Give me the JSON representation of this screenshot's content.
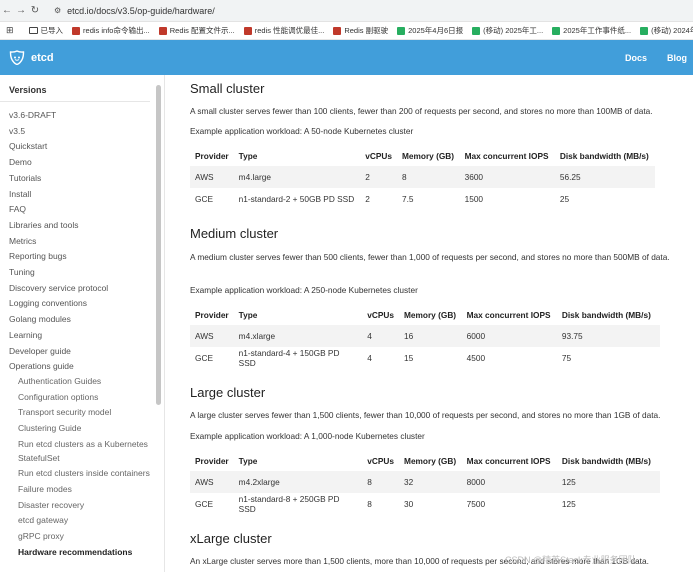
{
  "browser": {
    "url": "etcd.io/docs/v3.5/op-guide/hardware/",
    "bookmarks": [
      {
        "label": "已导入",
        "color": "#555"
      },
      {
        "label": "redis info命令输出...",
        "color": "#c0392b"
      },
      {
        "label": "Redis 配置文件示...",
        "color": "#c0392b"
      },
      {
        "label": "redis 性能调优最佳...",
        "color": "#c0392b"
      },
      {
        "label": "Redis 副驱驶",
        "color": "#c0392b"
      },
      {
        "label": "2025年4月6日报",
        "color": "#27ae60"
      },
      {
        "label": "(移动) 2025年工...",
        "color": "#27ae60"
      },
      {
        "label": "2025年工作事件纸...",
        "color": "#27ae60"
      },
      {
        "label": "(移动) 2024年工...",
        "color": "#27ae60"
      }
    ]
  },
  "header": {
    "brand": "etcd",
    "nav": [
      "Docs",
      "Blog"
    ],
    "color": "#419eda"
  },
  "sidebar": {
    "heading": "Versions",
    "items": [
      {
        "label": "v3.6-DRAFT",
        "sub": false
      },
      {
        "label": "v3.5",
        "sub": false
      },
      {
        "label": "Quickstart",
        "sub": false
      },
      {
        "label": "Demo",
        "sub": false
      },
      {
        "label": "Tutorials",
        "sub": false
      },
      {
        "label": "Install",
        "sub": false
      },
      {
        "label": "FAQ",
        "sub": false
      },
      {
        "label": "Libraries and tools",
        "sub": false
      },
      {
        "label": "Metrics",
        "sub": false
      },
      {
        "label": "Reporting bugs",
        "sub": false
      },
      {
        "label": "Tuning",
        "sub": false
      },
      {
        "label": "Discovery service protocol",
        "sub": false
      },
      {
        "label": "Logging conventions",
        "sub": false
      },
      {
        "label": "Golang modules",
        "sub": false
      },
      {
        "label": "Learning",
        "sub": false
      },
      {
        "label": "Developer guide",
        "sub": false
      },
      {
        "label": "Operations guide",
        "sub": false
      },
      {
        "label": "Authentication Guides",
        "sub": true
      },
      {
        "label": "Configuration options",
        "sub": true
      },
      {
        "label": "Transport security model",
        "sub": true
      },
      {
        "label": "Clustering Guide",
        "sub": true
      },
      {
        "label": "Run etcd clusters as a Kubernetes StatefulSet",
        "sub": true
      },
      {
        "label": "Run etcd clusters inside containers",
        "sub": true
      },
      {
        "label": "Failure modes",
        "sub": true
      },
      {
        "label": "Disaster recovery",
        "sub": true
      },
      {
        "label": "etcd gateway",
        "sub": true
      },
      {
        "label": "gRPC proxy",
        "sub": true
      },
      {
        "label": "Hardware recommendations",
        "sub": true,
        "active": true
      }
    ]
  },
  "content": {
    "columns": [
      "Provider",
      "Type",
      "vCPUs",
      "Memory (GB)",
      "Max concurrent IOPS",
      "Disk bandwidth (MB/s)"
    ],
    "sections": [
      {
        "title": "Small cluster",
        "desc": "A small cluster serves fewer than 100 clients, fewer than 200 of requests per second, and stores no more than 100MB of data.",
        "example": "Example application workload: A 50-node Kubernetes cluster",
        "rows": [
          [
            "AWS",
            "m4.large",
            "2",
            "8",
            "3600",
            "56.25"
          ],
          [
            "GCE",
            "n1-standard-2 + 50GB PD SSD",
            "2",
            "7.5",
            "1500",
            "25"
          ]
        ]
      },
      {
        "title": "Medium cluster",
        "desc": "A medium cluster serves fewer than 500 clients, fewer than 1,000 of requests per second, and stores no more than 500MB of data.",
        "example": "Example application workload: A 250-node Kubernetes cluster",
        "rows": [
          [
            "AWS",
            "m4.xlarge",
            "4",
            "16",
            "6000",
            "93.75"
          ],
          [
            "GCE",
            "n1-standard-4 + 150GB PD SSD",
            "4",
            "15",
            "4500",
            "75"
          ]
        ]
      },
      {
        "title": "Large cluster",
        "desc": "A large cluster serves fewer than 1,500 clients, fewer than 10,000 of requests per second, and stores no more than 1GB of data.",
        "example": "Example application workload: A 1,000-node Kubernetes cluster",
        "rows": [
          [
            "AWS",
            "m4.2xlarge",
            "8",
            "32",
            "8000",
            "125"
          ],
          [
            "GCE",
            "n1-standard-8 + 250GB PD SSD",
            "8",
            "30",
            "7500",
            "125"
          ]
        ]
      },
      {
        "title": "xLarge cluster",
        "desc": "An xLarge cluster serves more than 1,500 clients, more than 10,000 of requests per second, and stores more than 1GB data.",
        "example": "",
        "rows": []
      }
    ]
  },
  "watermark": "CSDN @精英Stack专业服务团队"
}
